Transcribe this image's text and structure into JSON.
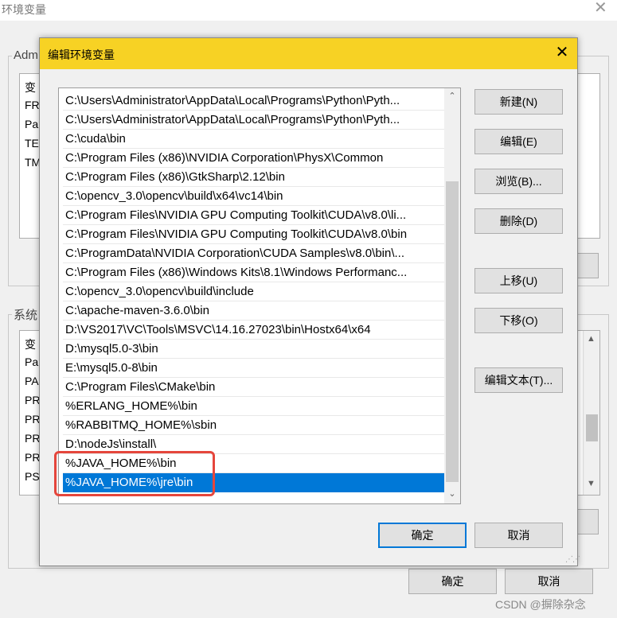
{
  "bg_window": {
    "title": "环境变量",
    "close": "✕",
    "user_group_label": "Adm",
    "user_rows": [
      "变",
      "FR",
      "Pa",
      "TE",
      "TM"
    ],
    "system_group_label": "系统",
    "system_rows": [
      "变",
      "Pa",
      "PA",
      "PR",
      "PR",
      "PR",
      "PR",
      "PS"
    ],
    "ok_label": "确定",
    "cancel_label": "取消"
  },
  "dialog": {
    "title": "编辑环境变量",
    "close": "✕",
    "paths": [
      "C:\\Users\\Administrator\\AppData\\Local\\Programs\\Python\\Pyth...",
      "C:\\Users\\Administrator\\AppData\\Local\\Programs\\Python\\Pyth...",
      "C:\\cuda\\bin",
      "C:\\Program Files (x86)\\NVIDIA Corporation\\PhysX\\Common",
      "C:\\Program Files (x86)\\GtkSharp\\2.12\\bin",
      "C:\\opencv_3.0\\opencv\\build\\x64\\vc14\\bin",
      "C:\\Program Files\\NVIDIA GPU Computing Toolkit\\CUDA\\v8.0\\li...",
      "C:\\Program Files\\NVIDIA GPU Computing Toolkit\\CUDA\\v8.0\\bin",
      "C:\\ProgramData\\NVIDIA Corporation\\CUDA Samples\\v8.0\\bin\\...",
      "C:\\Program Files (x86)\\Windows Kits\\8.1\\Windows Performanc...",
      "C:\\opencv_3.0\\opencv\\build\\include",
      "C:\\apache-maven-3.6.0\\bin",
      "D:\\VS2017\\VC\\Tools\\MSVC\\14.16.27023\\bin\\Hostx64\\x64",
      "D:\\mysql5.0-3\\bin",
      "E:\\mysql5.0-8\\bin",
      "C:\\Program Files\\CMake\\bin",
      "%ERLANG_HOME%\\bin",
      "%RABBITMQ_HOME%\\sbin",
      "D:\\nodeJs\\install\\",
      "%JAVA_HOME%\\bin",
      "%JAVA_HOME%\\jre\\bin"
    ],
    "selected_index": 20,
    "buttons": {
      "new": "新建(N)",
      "edit": "编辑(E)",
      "browse": "浏览(B)...",
      "delete": "删除(D)",
      "move_up": "上移(U)",
      "move_down": "下移(O)",
      "edit_text": "编辑文本(T)...",
      "ok": "确定",
      "cancel": "取消"
    }
  },
  "watermark": "CSDN @摒除杂念",
  "colors": {
    "title_bar": "#f7d224",
    "selection": "#0078d7",
    "highlight_box": "#e5463c"
  }
}
